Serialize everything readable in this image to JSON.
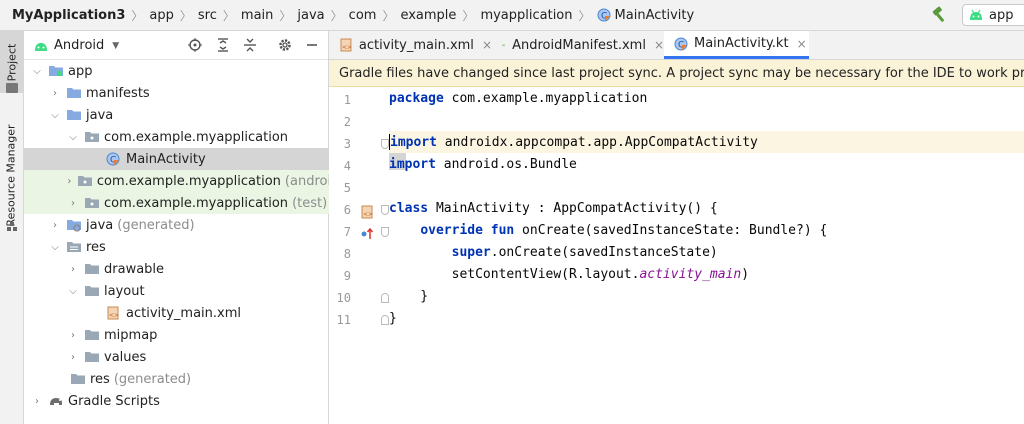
{
  "breadcrumbs": [
    "MyApplication3",
    "app",
    "src",
    "main",
    "java",
    "com",
    "example",
    "myapplication",
    "MainActivity"
  ],
  "run_config": {
    "label": "app"
  },
  "tool_window_tabs": [
    "Project",
    "Resource Manager"
  ],
  "project_panel": {
    "view_mode": "Android",
    "tree": [
      {
        "label": "app",
        "dim": ""
      },
      {
        "label": "manifests",
        "dim": ""
      },
      {
        "label": "java",
        "dim": ""
      },
      {
        "label": "com.example.myapplication",
        "dim": ""
      },
      {
        "label": "MainActivity",
        "dim": ""
      },
      {
        "label": "com.example.myapplication",
        "dim": "(androidTest)"
      },
      {
        "label": "com.example.myapplication",
        "dim": "(test)"
      },
      {
        "label": "java",
        "dim": "(generated)"
      },
      {
        "label": "res",
        "dim": ""
      },
      {
        "label": "drawable",
        "dim": ""
      },
      {
        "label": "layout",
        "dim": ""
      },
      {
        "label": "activity_main.xml",
        "dim": ""
      },
      {
        "label": "mipmap",
        "dim": ""
      },
      {
        "label": "values",
        "dim": ""
      },
      {
        "label": "res",
        "dim": "(generated)"
      },
      {
        "label": "Gradle Scripts",
        "dim": ""
      }
    ]
  },
  "editor_tabs": [
    "activity_main.xml",
    "AndroidManifest.xml",
    "MainActivity.kt"
  ],
  "tab_icon_text": {
    "manifest": "MF"
  },
  "close_glyph": "×",
  "banner": "Gradle files have changed since last project sync. A project sync may be necessary for the IDE to work properly.",
  "code": {
    "line_numbers": [
      "1",
      "2",
      "3",
      "4",
      "5",
      "6",
      "7",
      "8",
      "9",
      "10",
      "11"
    ],
    "lines": [
      [
        {
          "t": "package",
          "s": "kw"
        },
        {
          "t": " com.example.myapplication",
          "s": ""
        }
      ],
      [],
      [
        {
          "t": "import",
          "s": "kw"
        },
        {
          "t": " androidx.appcompat.app.AppCompatActivity",
          "s": ""
        }
      ],
      [
        {
          "t": "import",
          "s": "kw"
        },
        {
          "t": " android.os.Bundle",
          "s": ""
        }
      ],
      [],
      [
        {
          "t": "class",
          "s": "kw"
        },
        {
          "t": " MainActivity : AppCompatActivity() {",
          "s": ""
        }
      ],
      [
        {
          "t": "    ",
          "s": ""
        },
        {
          "t": "override fun",
          "s": "kw"
        },
        {
          "t": " onCreate(savedInstanceState: Bundle?) {",
          "s": ""
        }
      ],
      [
        {
          "t": "        ",
          "s": ""
        },
        {
          "t": "super",
          "s": "kw"
        },
        {
          "t": ".onCreate(savedInstanceState)",
          "s": ""
        }
      ],
      [
        {
          "t": "        setContentView(R.layout.",
          "s": ""
        },
        {
          "t": "activity_main",
          "s": "it"
        },
        {
          "t": ")",
          "s": ""
        }
      ],
      [
        {
          "t": "    }",
          "s": ""
        }
      ],
      [
        {
          "t": "}",
          "s": ""
        }
      ]
    ]
  },
  "colors": {
    "accent": "#3574f0",
    "banner": "#fbf3d8",
    "keyword": "#0033b3",
    "android_green": "#3ddc84"
  }
}
